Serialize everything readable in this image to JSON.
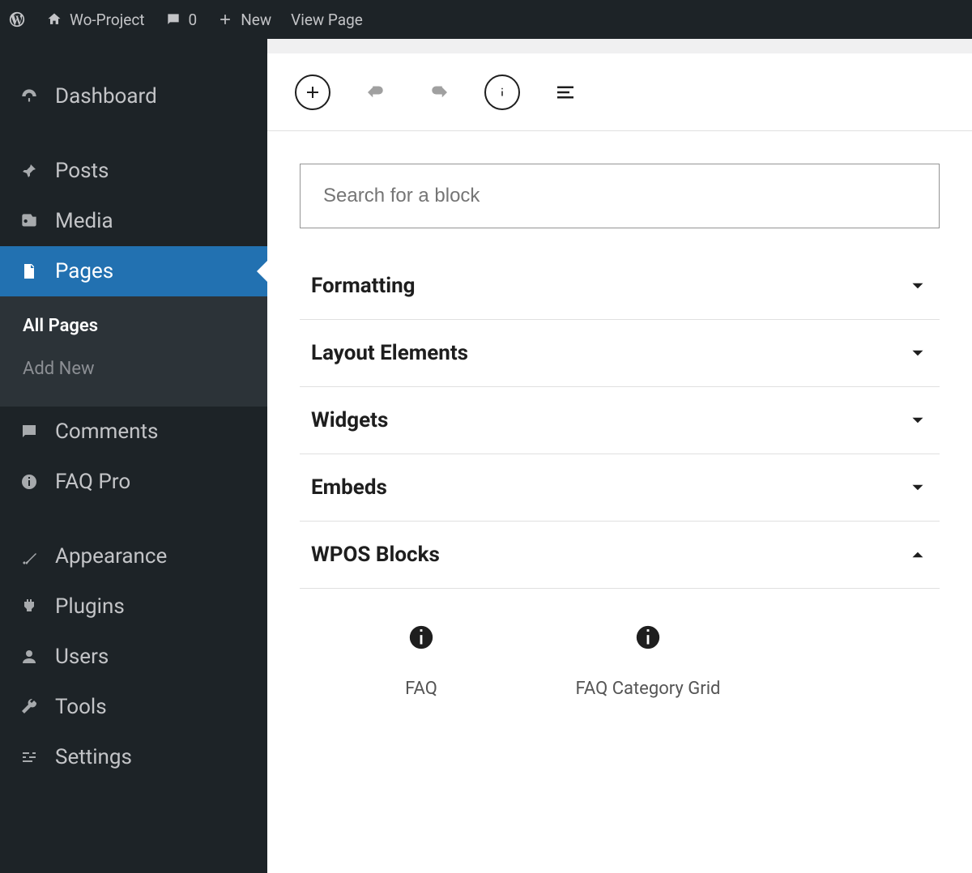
{
  "adminbar": {
    "site_name": "Wo-Project",
    "comments_count": "0",
    "new_label": "New",
    "view_page_label": "View Page"
  },
  "sidebar": {
    "items": [
      {
        "label": "Dashboard"
      },
      {
        "label": "Posts"
      },
      {
        "label": "Media"
      },
      {
        "label": "Pages"
      },
      {
        "label": "Comments"
      },
      {
        "label": "FAQ Pro"
      },
      {
        "label": "Appearance"
      },
      {
        "label": "Plugins"
      },
      {
        "label": "Users"
      },
      {
        "label": "Tools"
      },
      {
        "label": "Settings"
      }
    ],
    "pages_submenu": {
      "all_pages": "All Pages",
      "add_new": "Add New"
    }
  },
  "inserter": {
    "search_placeholder": "Search for a block",
    "categories": [
      {
        "label": "Formatting",
        "open": false
      },
      {
        "label": "Layout Elements",
        "open": false
      },
      {
        "label": "Widgets",
        "open": false
      },
      {
        "label": "Embeds",
        "open": false
      },
      {
        "label": "WPOS Blocks",
        "open": true
      }
    ],
    "wpos_blocks": [
      {
        "label": "FAQ"
      },
      {
        "label": "FAQ Category Grid"
      }
    ]
  }
}
